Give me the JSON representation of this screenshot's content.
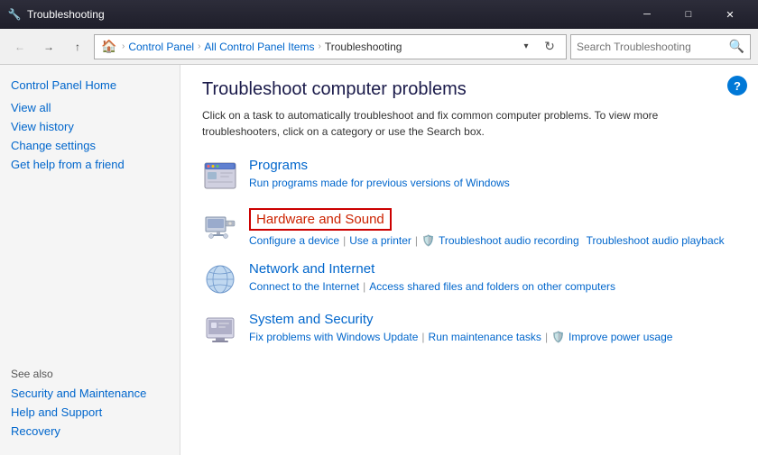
{
  "titleBar": {
    "icon": "🔧",
    "title": "Troubleshooting",
    "minimizeLabel": "─",
    "maximizeLabel": "□",
    "closeLabel": "✕"
  },
  "navBar": {
    "backBtn": "←",
    "forwardBtn": "→",
    "upBtn": "↑",
    "addressParts": [
      "Control Panel",
      "All Control Panel Items",
      "Troubleshooting"
    ],
    "dropdownBtn": "▾",
    "refreshBtn": "↻",
    "searchPlaceholder": "Search Troubleshooting",
    "searchIcon": "🔍"
  },
  "sidebar": {
    "homeLink": "Control Panel Home",
    "links": [
      {
        "id": "view-all",
        "label": "View all"
      },
      {
        "id": "view-history",
        "label": "View history"
      },
      {
        "id": "change-settings",
        "label": "Change settings"
      },
      {
        "id": "get-help",
        "label": "Get help from a friend"
      }
    ],
    "seeAlso": "See also",
    "seeAlsoLinks": [
      {
        "id": "security-maintenance",
        "label": "Security and Maintenance"
      },
      {
        "id": "help-support",
        "label": "Help and Support"
      },
      {
        "id": "recovery",
        "label": "Recovery"
      }
    ]
  },
  "content": {
    "title": "Troubleshoot computer problems",
    "description": "Click on a task to automatically troubleshoot and fix common computer problems. To view more troubleshooters, click on a category or use the Search box.",
    "helpBtn": "?",
    "categories": [
      {
        "id": "programs",
        "title": "Programs",
        "highlighted": false,
        "subtitle": "Run programs made for previous versions of Windows",
        "links": []
      },
      {
        "id": "hardware-sound",
        "title": "Hardware and Sound",
        "highlighted": true,
        "subtitle": "",
        "links": [
          {
            "label": "Configure a device",
            "shield": false
          },
          {
            "label": "Use a printer",
            "shield": false
          },
          {
            "label": "Troubleshoot audio recording",
            "shield": true
          },
          {
            "label": "Troubleshoot audio playback",
            "shield": false
          }
        ]
      },
      {
        "id": "network-internet",
        "title": "Network and Internet",
        "highlighted": false,
        "subtitle": "",
        "links": [
          {
            "label": "Connect to the Internet",
            "shield": false
          },
          {
            "label": "Access shared files and folders on other computers",
            "shield": false
          }
        ]
      },
      {
        "id": "system-security",
        "title": "System and Security",
        "highlighted": false,
        "subtitle": "",
        "links": [
          {
            "label": "Fix problems with Windows Update",
            "shield": false
          },
          {
            "label": "Run maintenance tasks",
            "shield": false
          },
          {
            "label": "Improve power usage",
            "shield": true
          }
        ]
      }
    ]
  }
}
